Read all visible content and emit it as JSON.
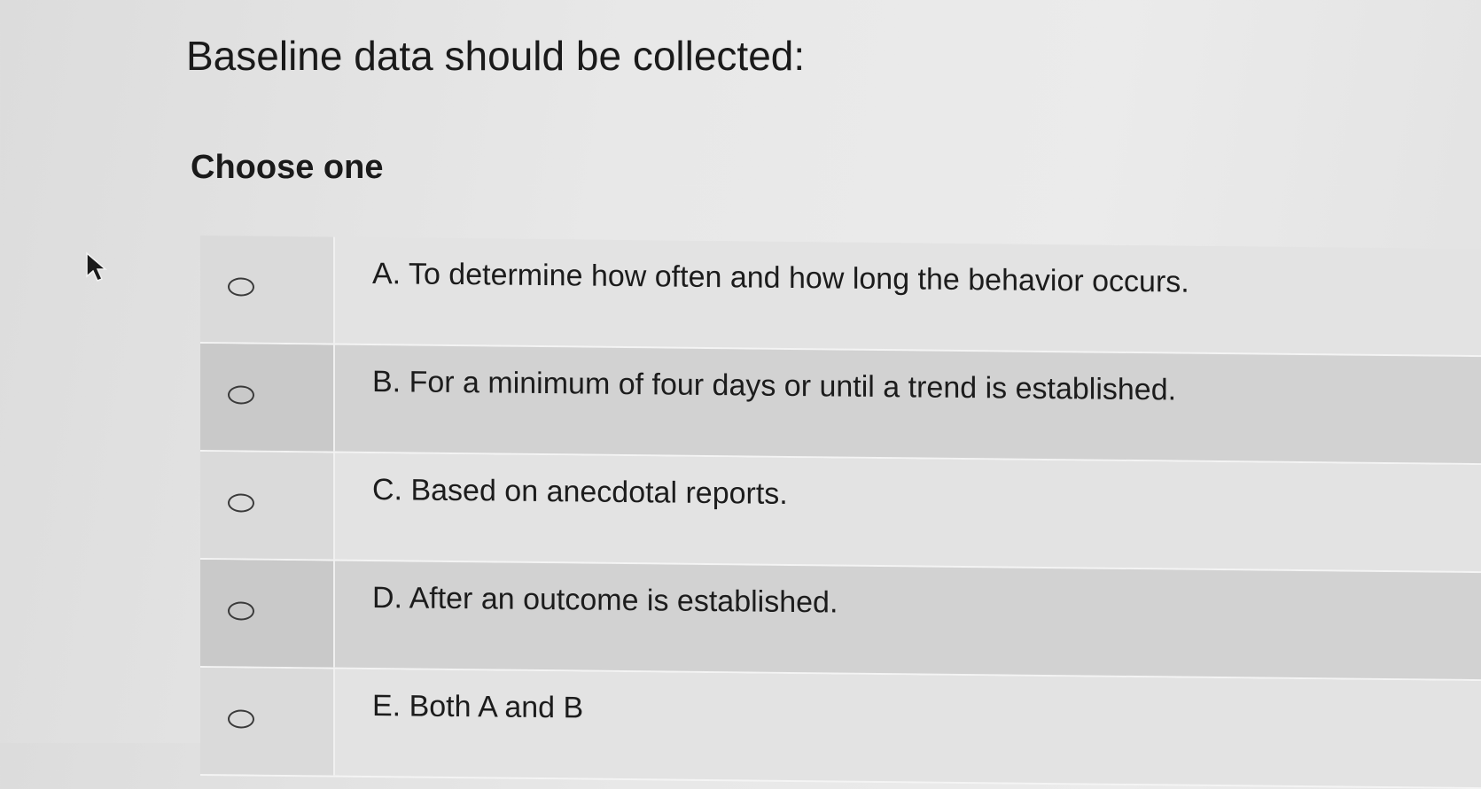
{
  "question": {
    "title": "Baseline data should be collected:",
    "instruction": "Choose one"
  },
  "options": [
    {
      "label": "A. To determine how often and how long the behavior occurs.",
      "selected": false
    },
    {
      "label": "B. For a minimum of four days or until a trend is established.",
      "selected": false
    },
    {
      "label": "C. Based on anecdotal reports.",
      "selected": false
    },
    {
      "label": "D. After an outcome is established.",
      "selected": false
    },
    {
      "label": "E. Both A and B",
      "selected": false
    }
  ],
  "cursor": {
    "icon": "mouse-pointer-icon"
  }
}
